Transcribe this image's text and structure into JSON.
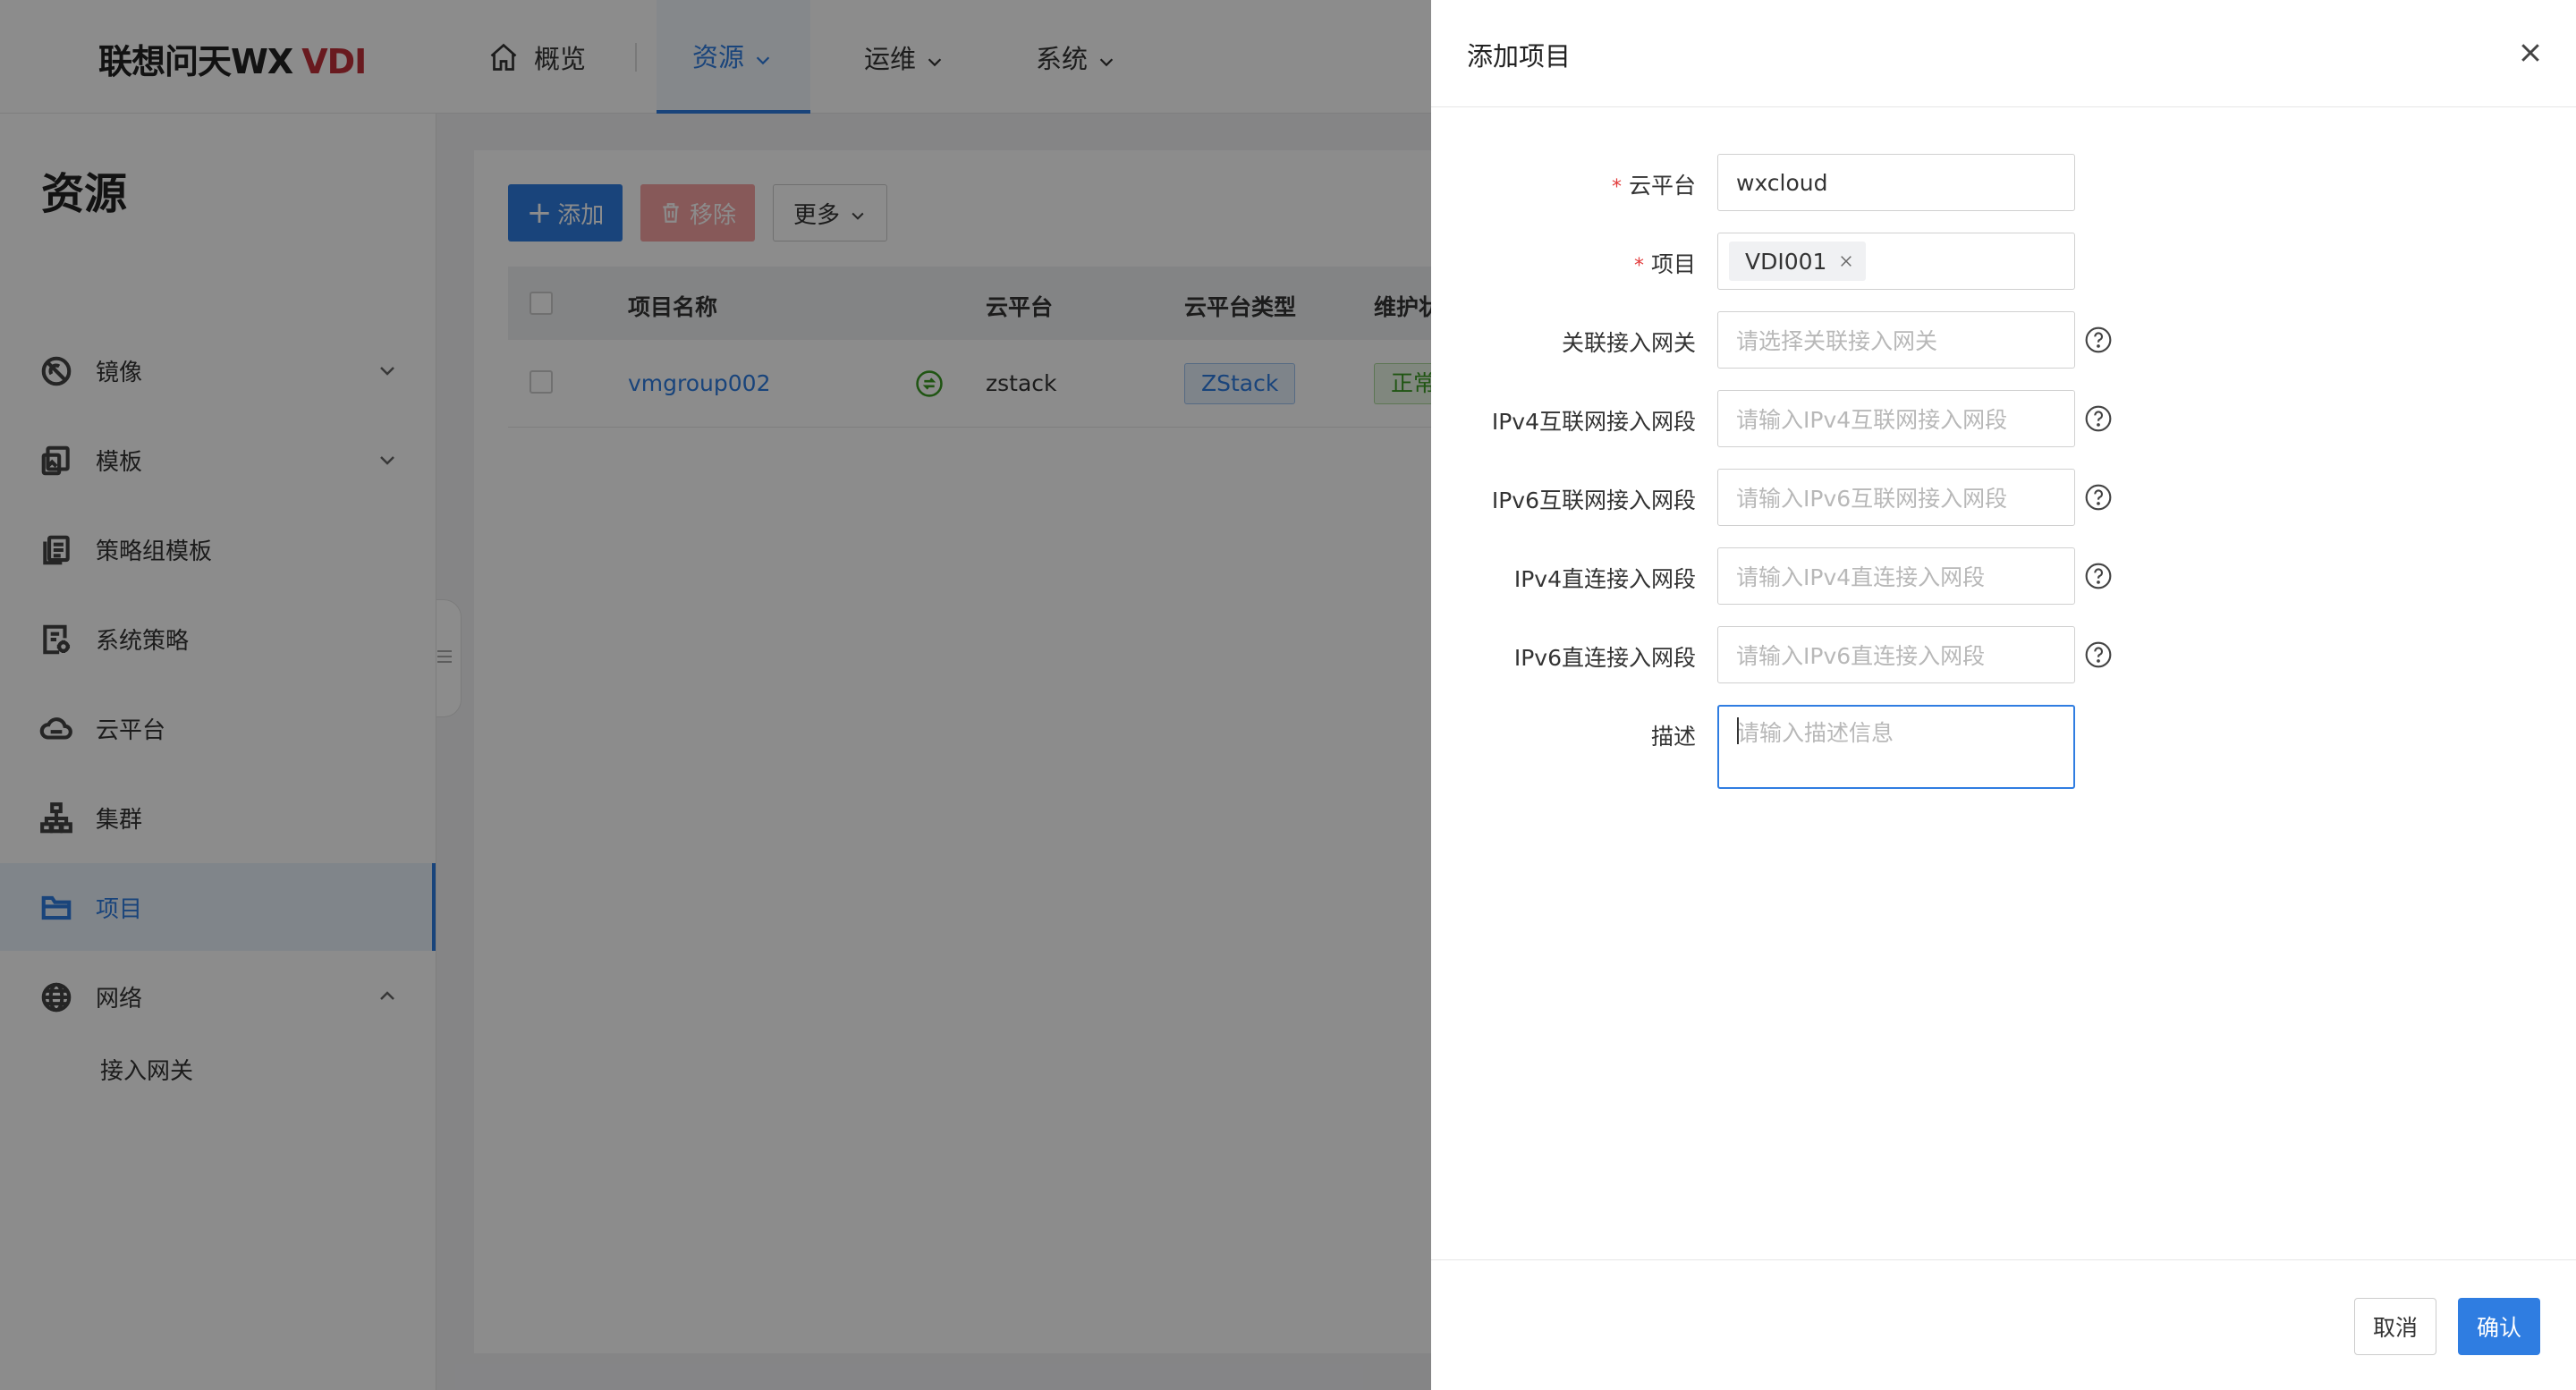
{
  "header": {
    "logo_text": "联想问天WX",
    "logo_accent": "VDI",
    "nav": [
      {
        "label": "概览"
      },
      {
        "label": "资源"
      },
      {
        "label": "运维"
      },
      {
        "label": "系统"
      }
    ]
  },
  "sidebar": {
    "title": "资源",
    "items": [
      {
        "label": "镜像"
      },
      {
        "label": "模板"
      },
      {
        "label": "策略组模板"
      },
      {
        "label": "系统策略"
      },
      {
        "label": "云平台"
      },
      {
        "label": "集群"
      },
      {
        "label": "项目"
      },
      {
        "label": "网络"
      }
    ],
    "sub_items": [
      {
        "label": "接入网关"
      }
    ]
  },
  "toolbar": {
    "add_label": "添加",
    "remove_label": "移除",
    "more_label": "更多"
  },
  "table": {
    "columns": [
      "项目名称",
      "云平台",
      "云平台类型",
      "维护状"
    ],
    "rows": [
      {
        "name": "vmgroup002",
        "platform": "zstack",
        "platform_type": "ZStack",
        "status": "正常"
      }
    ]
  },
  "drawer": {
    "title": "添加项目",
    "fields": {
      "cloud_platform": {
        "label": "云平台",
        "value": "wxcloud"
      },
      "project": {
        "label": "项目",
        "chip": "VDI001"
      },
      "gateway": {
        "label": "关联接入网关",
        "placeholder": "请选择关联接入网关"
      },
      "ipv4_internet": {
        "label": "IPv4互联网接入网段",
        "placeholder": "请输入IPv4互联网接入网段"
      },
      "ipv6_internet": {
        "label": "IPv6互联网接入网段",
        "placeholder": "请输入IPv6互联网接入网段"
      },
      "ipv4_direct": {
        "label": "IPv4直连接入网段",
        "placeholder": "请输入IPv4直连接入网段"
      },
      "ipv6_direct": {
        "label": "IPv6直连接入网段",
        "placeholder": "请输入IPv6直连接入网段"
      },
      "description": {
        "label": "描述",
        "placeholder": "请输入描述信息"
      }
    },
    "cancel_label": "取消",
    "confirm_label": "确认"
  },
  "colors": {
    "primary": "#2f7de1",
    "danger": "#f6a3a3",
    "required": "#e23c3c",
    "brand_accent": "#c0303a"
  }
}
